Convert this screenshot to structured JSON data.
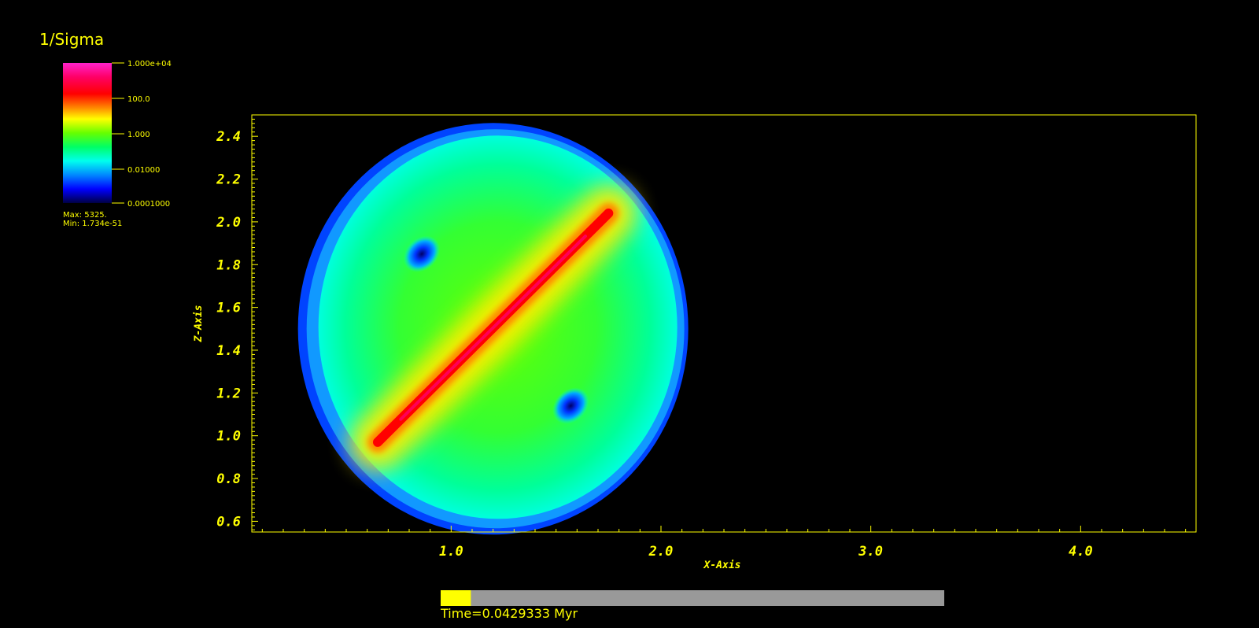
{
  "colors": {
    "background": "#000000",
    "annotation": "#ffff00",
    "progress_track": "#999999",
    "progress_fill": "#ffff00"
  },
  "legend": {
    "title": "1/Sigma",
    "scale": "log",
    "tick_labels": [
      "1.000e+04",
      "100.0",
      "1.000",
      "0.01000",
      "0.0001000"
    ],
    "max_label": "Max:  5325.",
    "min_label": "Min:  1.734e-51"
  },
  "chart_data": {
    "type": "heatmap",
    "title": "",
    "xlabel": "X-Axis",
    "ylabel": "Z-Axis",
    "xlim": [
      0.05,
      4.55
    ],
    "ylim": [
      0.55,
      2.5
    ],
    "x_ticks": [
      "1.0",
      "2.0",
      "3.0",
      "4.0"
    ],
    "x_tick_values": [
      1.0,
      2.0,
      3.0,
      4.0
    ],
    "y_ticks": [
      "0.6",
      "0.8",
      "1.0",
      "1.2",
      "1.4",
      "1.6",
      "1.8",
      "2.0",
      "2.2",
      "2.4"
    ],
    "y_tick_values": [
      0.6,
      0.8,
      1.0,
      1.2,
      1.4,
      1.6,
      1.8,
      2.0,
      2.2,
      2.4
    ],
    "colormap_range": [
      0.0001,
      10000
    ],
    "features": {
      "disk_center": [
        1.2,
        1.5
      ],
      "disk_radius_x": 0.9,
      "disk_radius_z": 0.94,
      "filament_start": [
        0.65,
        0.97
      ],
      "filament_end": [
        1.75,
        2.04
      ],
      "low_spots": [
        [
          0.86,
          1.85
        ],
        [
          1.57,
          1.14
        ]
      ]
    }
  },
  "time_bar": {
    "label": "Time=0.0429333 Myr",
    "progress": 0.06
  }
}
